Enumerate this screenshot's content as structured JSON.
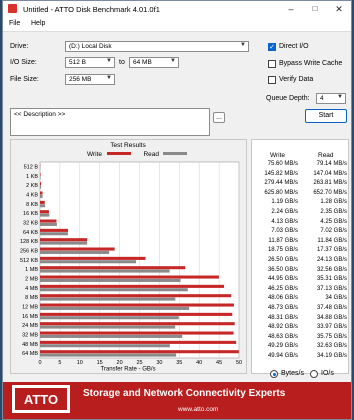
{
  "window": {
    "title": "Untitled - ATTO Disk Benchmark 4.01.0f1"
  },
  "menu": [
    "File",
    "Help"
  ],
  "controls": {
    "drive_label": "Drive:",
    "drive_value": "(D:) Local Disk",
    "io_label": "I/O Size:",
    "io_from": "512 B",
    "io_to_word": "to",
    "io_to": "64 MB",
    "file_label": "File Size:",
    "file_value": "256 MB",
    "direct_io": "Direct I/O",
    "bypass_cache": "Bypass Write Cache",
    "verify_data": "Verify Data",
    "queue_label": "Queue Depth:",
    "queue_value": "4",
    "dots": "...",
    "start": "Start",
    "description": "<< Description >>"
  },
  "chart_data": {
    "type": "bar",
    "title": "Test Results",
    "xlabel": "Transfer Rate - GB/s",
    "xlim": [
      0,
      50
    ],
    "xticks": [
      "0",
      "5",
      "10",
      "15",
      "20",
      "25",
      "30",
      "35",
      "40",
      "45",
      "50"
    ],
    "categories": [
      "512 B",
      "1 KB",
      "2 KB",
      "4 KB",
      "8 KB",
      "16 KB",
      "32 KB",
      "64 KB",
      "128 KB",
      "256 KB",
      "512 KB",
      "1 MB",
      "2 MB",
      "4 MB",
      "8 MB",
      "12 MB",
      "16 MB",
      "24 MB",
      "32 MB",
      "48 MB",
      "64 MB"
    ],
    "series": [
      {
        "name": "Write",
        "color": "#c62828",
        "values": [
          0.0756,
          0.1458,
          0.2794,
          0.6258,
          1.19,
          2.24,
          4.13,
          7.03,
          11.87,
          18.75,
          26.5,
          36.5,
          44.95,
          46.25,
          48.06,
          48.73,
          48.31,
          48.92,
          48.63,
          49.29,
          49.94
        ]
      },
      {
        "name": "Read",
        "color": "#8a8a8a",
        "values": [
          0.0791,
          0.147,
          0.2638,
          0.6527,
          1.28,
          2.35,
          4.25,
          7.02,
          11.84,
          17.37,
          24.13,
          32.56,
          35.31,
          37.13,
          34,
          37.48,
          34.88,
          33.97,
          35.75,
          32.63,
          34.19
        ]
      }
    ]
  },
  "results": {
    "write_header": "Write",
    "read_header": "Read",
    "rows": [
      {
        "w": "75.60 MB/s",
        "r": "79.14 MB/s"
      },
      {
        "w": "145.82 MB/s",
        "r": "147.04 MB/s"
      },
      {
        "w": "279.44 MB/s",
        "r": "263.81 MB/s"
      },
      {
        "w": "625.80 MB/s",
        "r": "652.70 MB/s"
      },
      {
        "w": "1.19 GB/s",
        "r": "1.28 GB/s"
      },
      {
        "w": "2.24 GB/s",
        "r": "2.35 GB/s"
      },
      {
        "w": "4.13 GB/s",
        "r": "4.25 GB/s"
      },
      {
        "w": "7.03 GB/s",
        "r": "7.02 GB/s"
      },
      {
        "w": "11.87 GB/s",
        "r": "11.84 GB/s"
      },
      {
        "w": "18.75 GB/s",
        "r": "17.37 GB/s"
      },
      {
        "w": "26.50 GB/s",
        "r": "24.13 GB/s"
      },
      {
        "w": "36.50 GB/s",
        "r": "32.56 GB/s"
      },
      {
        "w": "44.95 GB/s",
        "r": "35.31 GB/s"
      },
      {
        "w": "46.25 GB/s",
        "r": "37.13 GB/s"
      },
      {
        "w": "48.06 GB/s",
        "r": "34 GB/s"
      },
      {
        "w": "48.73 GB/s",
        "r": "37.48 GB/s"
      },
      {
        "w": "48.31 GB/s",
        "r": "34.88 GB/s"
      },
      {
        "w": "48.92 GB/s",
        "r": "33.97 GB/s"
      },
      {
        "w": "48.63 GB/s",
        "r": "35.75 GB/s"
      },
      {
        "w": "49.29 GB/s",
        "r": "32.63 GB/s"
      },
      {
        "w": "49.94 GB/s",
        "r": "34.19 GB/s"
      }
    ]
  },
  "units": {
    "bytes": "Bytes/s",
    "io": "IO/s"
  },
  "banner": {
    "logo": "ATTO",
    "slogan": "Storage and Network Connectivity Experts",
    "url": "www.atto.com"
  }
}
